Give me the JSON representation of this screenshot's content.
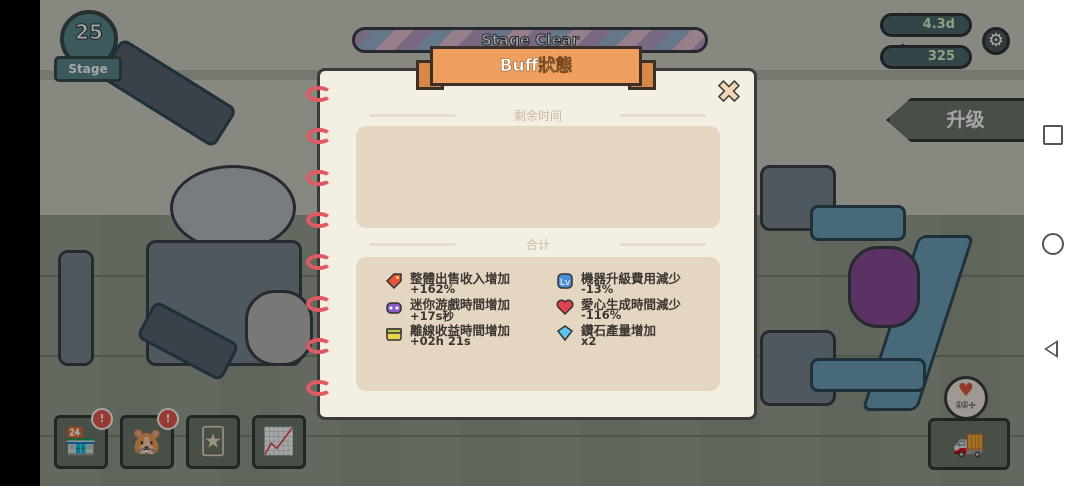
{
  "hud": {
    "stage_number": "25",
    "stage_label": "Stage",
    "stage_clear": "Stage Clear",
    "cash": "4.3d",
    "gems": "325",
    "cash_icon": "cash-icon",
    "gem_icon": "gem-icon",
    "settings_icon": "gear-icon",
    "upgrade_label": "升级"
  },
  "bottom_bar": {
    "notifications": [
      "!",
      "!"
    ],
    "heart_count": "99+"
  },
  "modal": {
    "title": "Buff狀態",
    "remaining_label": "剩余时间",
    "total_label": "合计",
    "buffs": [
      {
        "icon": "sell-tag-icon",
        "name": "整體出售收入增加",
        "value": "+162%"
      },
      {
        "icon": "machine-upgrade-icon",
        "name": "機器升級費用減少",
        "value": "-13%"
      },
      {
        "icon": "gamepad-icon",
        "name": "迷你游戲時間增加",
        "value": "+17s秒"
      },
      {
        "icon": "heart-icon",
        "name": "愛心生成時間減少",
        "value": "-116%"
      },
      {
        "icon": "offline-box-icon",
        "name": "離線收益時間增加",
        "value": "+02h 21s"
      },
      {
        "icon": "diamond-icon",
        "name": "鑽石產量增加",
        "value": "x2"
      }
    ]
  },
  "colors": {
    "ribbon": "#f0a05e",
    "panel": "#e5d6c2",
    "notebook": "#f4efe3",
    "ring": "#e05a63"
  }
}
